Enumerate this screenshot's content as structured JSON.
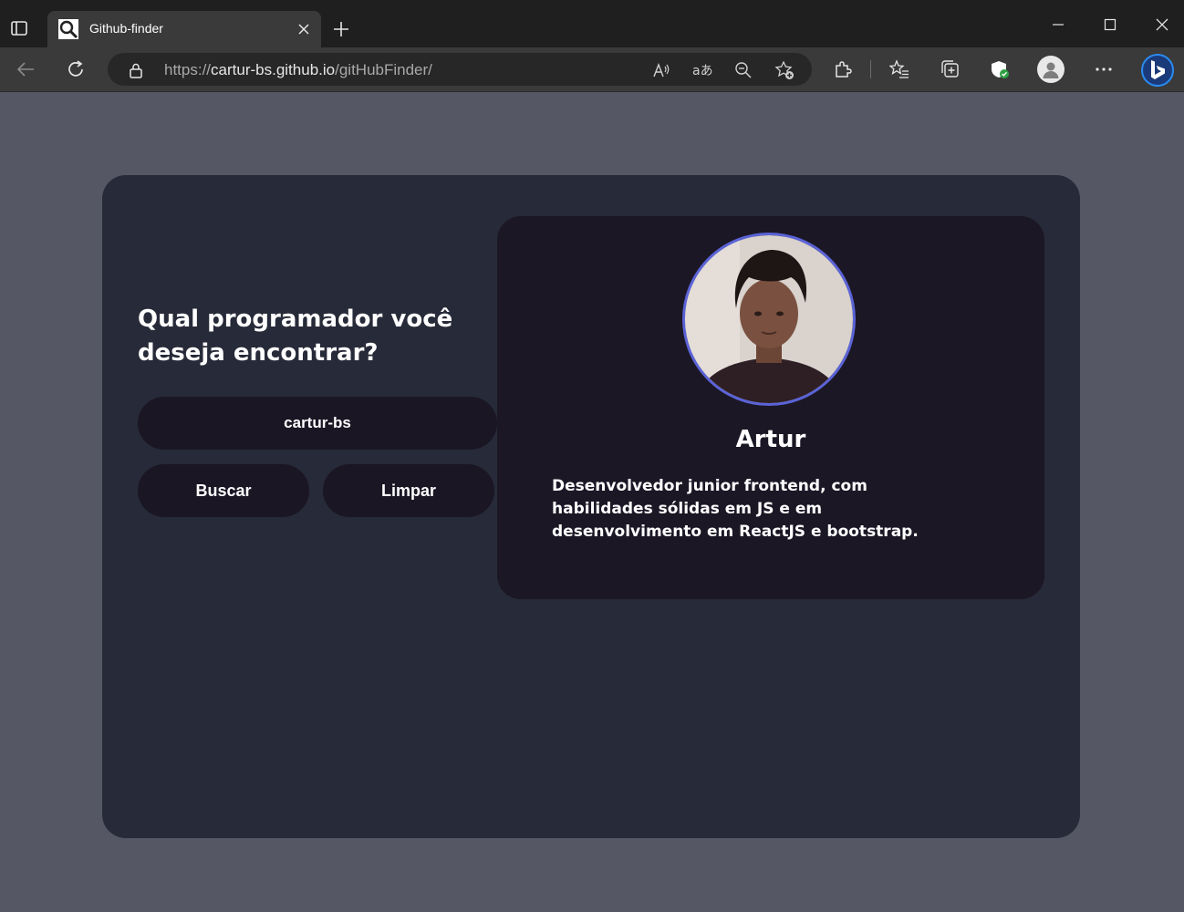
{
  "browser": {
    "tab": {
      "title": "Github-finder"
    },
    "url": {
      "scheme": "https://",
      "host": "cartur-bs.github.io",
      "path": "/gitHubFinder/"
    },
    "icons": [
      "tab-actions-icon",
      "search-favicon-icon",
      "close-icon",
      "new-tab-icon",
      "minimize-icon",
      "maximize-icon",
      "window-close-icon",
      "back-icon",
      "refresh-icon",
      "lock-icon",
      "read-aloud-icon",
      "translate-icon",
      "zoom-out-icon",
      "add-favorite-icon",
      "extensions-icon",
      "favorites-icon",
      "collections-icon",
      "browser-essentials-icon",
      "profile-icon",
      "more-icon",
      "bing-icon"
    ]
  },
  "search": {
    "question": "Qual programador você deseja encontrar?",
    "input_value": "cartur-bs",
    "search_label": "Buscar",
    "clear_label": "Limpar"
  },
  "profile": {
    "name": "Artur",
    "bio": "Desenvolvedor junior frontend, com habilidades sólidas em JS e em desenvolvimento em ReactJS e bootstrap."
  },
  "colors": {
    "page_bg": "#555764",
    "card_bg": "#272a38",
    "profile_bg": "#1b1725",
    "button_bg": "#1a1624",
    "avatar_border": "#5b63d8"
  }
}
